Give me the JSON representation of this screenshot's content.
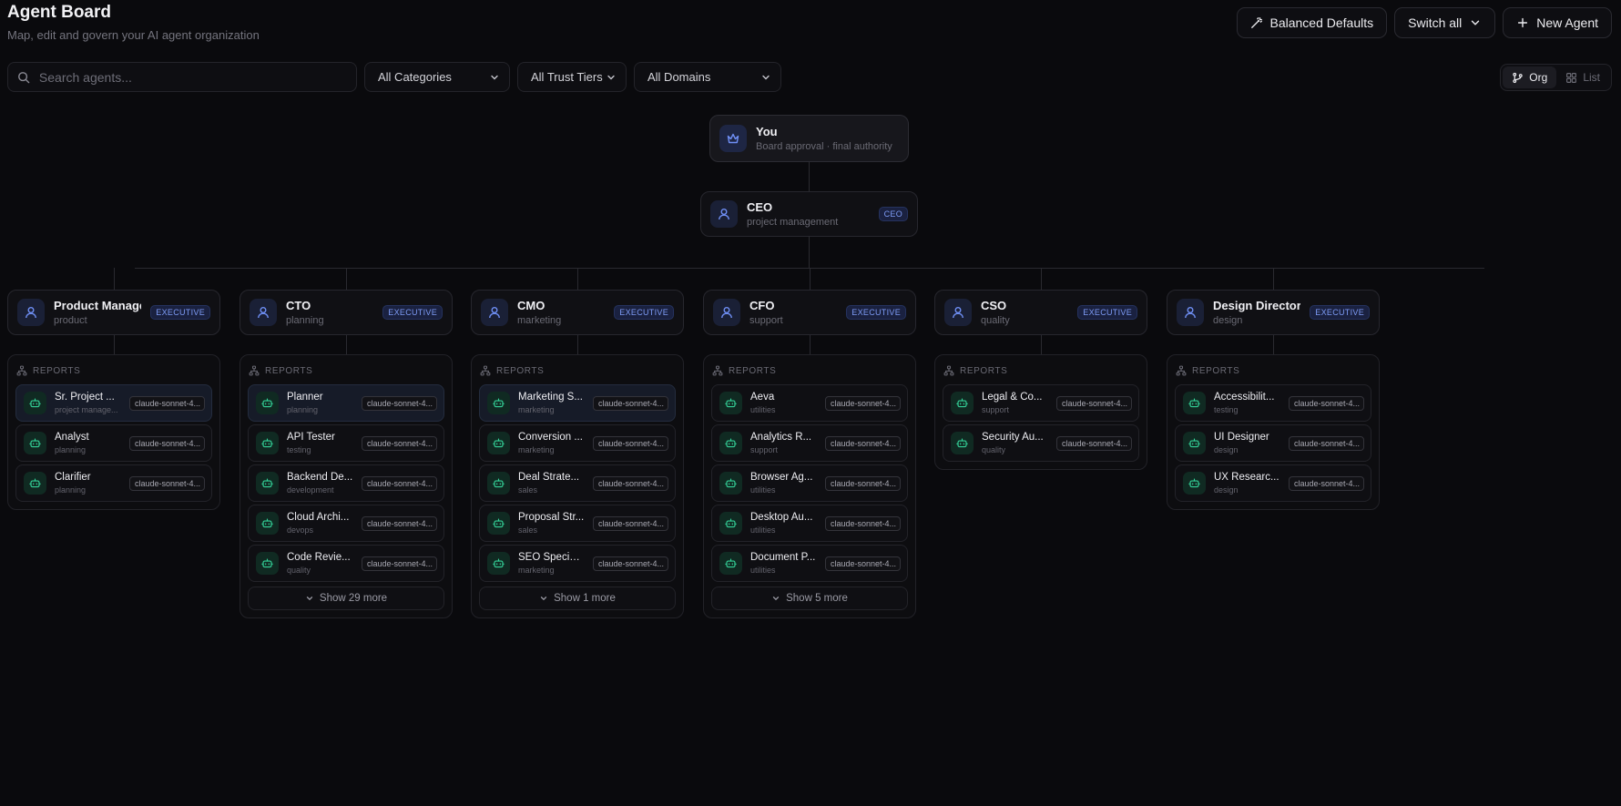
{
  "header": {
    "title": "Agent Board",
    "subtitle": "Map, edit and govern your AI agent organization"
  },
  "actions": {
    "balanced": "Balanced Defaults",
    "switch_all": "Switch all",
    "new_agent": "New Agent"
  },
  "search": {
    "placeholder": "Search agents..."
  },
  "filters": {
    "categories": "All Categories",
    "tiers": "All Trust Tiers",
    "domains": "All Domains"
  },
  "view": {
    "org": "Org",
    "list": "List",
    "active": "org"
  },
  "root": {
    "name": "You",
    "desc": "Board approval · final authority"
  },
  "ceo": {
    "name": "CEO",
    "desc": "project management",
    "badge": "CEO"
  },
  "reports_label": "REPORTS",
  "columns": [
    {
      "name": "Product Manager",
      "desc": "product",
      "badge": "EXECUTIVE",
      "reports": [
        {
          "name": "Sr. Project ...",
          "desc": "project manage...",
          "model": "claude-sonnet-4...",
          "highlight": true
        },
        {
          "name": "Analyst",
          "desc": "planning",
          "model": "claude-sonnet-4...",
          "highlight": false
        },
        {
          "name": "Clarifier",
          "desc": "planning",
          "model": "claude-sonnet-4...",
          "highlight": false
        }
      ],
      "more": ""
    },
    {
      "name": "CTO",
      "desc": "planning",
      "badge": "EXECUTIVE",
      "reports": [
        {
          "name": "Planner",
          "desc": "planning",
          "model": "claude-sonnet-4...",
          "highlight": true
        },
        {
          "name": "API Tester",
          "desc": "testing",
          "model": "claude-sonnet-4...",
          "highlight": false
        },
        {
          "name": "Backend De...",
          "desc": "development",
          "model": "claude-sonnet-4...",
          "highlight": false
        },
        {
          "name": "Cloud Archi...",
          "desc": "devops",
          "model": "claude-sonnet-4...",
          "highlight": false
        },
        {
          "name": "Code Revie...",
          "desc": "quality",
          "model": "claude-sonnet-4...",
          "highlight": false
        }
      ],
      "more": "Show 29 more"
    },
    {
      "name": "CMO",
      "desc": "marketing",
      "badge": "EXECUTIVE",
      "reports": [
        {
          "name": "Marketing S...",
          "desc": "marketing",
          "model": "claude-sonnet-4...",
          "highlight": true
        },
        {
          "name": "Conversion ...",
          "desc": "marketing",
          "model": "claude-sonnet-4...",
          "highlight": false
        },
        {
          "name": "Deal Strate...",
          "desc": "sales",
          "model": "claude-sonnet-4...",
          "highlight": false
        },
        {
          "name": "Proposal Str...",
          "desc": "sales",
          "model": "claude-sonnet-4...",
          "highlight": false
        },
        {
          "name": "SEO Special...",
          "desc": "marketing",
          "model": "claude-sonnet-4...",
          "highlight": false
        }
      ],
      "more": "Show 1 more"
    },
    {
      "name": "CFO",
      "desc": "support",
      "badge": "EXECUTIVE",
      "reports": [
        {
          "name": "Aeva",
          "desc": "utilities",
          "model": "claude-sonnet-4...",
          "highlight": false
        },
        {
          "name": "Analytics R...",
          "desc": "support",
          "model": "claude-sonnet-4...",
          "highlight": false
        },
        {
          "name": "Browser Ag...",
          "desc": "utilities",
          "model": "claude-sonnet-4...",
          "highlight": false
        },
        {
          "name": "Desktop Au...",
          "desc": "utilities",
          "model": "claude-sonnet-4...",
          "highlight": false
        },
        {
          "name": "Document P...",
          "desc": "utilities",
          "model": "claude-sonnet-4...",
          "highlight": false
        }
      ],
      "more": "Show 5 more"
    },
    {
      "name": "CSO",
      "desc": "quality",
      "badge": "EXECUTIVE",
      "reports": [
        {
          "name": "Legal & Co...",
          "desc": "support",
          "model": "claude-sonnet-4...",
          "highlight": false
        },
        {
          "name": "Security Au...",
          "desc": "quality",
          "model": "claude-sonnet-4...",
          "highlight": false
        }
      ],
      "more": ""
    },
    {
      "name": "Design Director",
      "desc": "design",
      "badge": "EXECUTIVE",
      "reports": [
        {
          "name": "Accessibilit...",
          "desc": "testing",
          "model": "claude-sonnet-4...",
          "highlight": false
        },
        {
          "name": "UI Designer",
          "desc": "design",
          "model": "claude-sonnet-4...",
          "highlight": false
        },
        {
          "name": "UX Researc...",
          "desc": "design",
          "model": "claude-sonnet-4...",
          "highlight": false
        }
      ],
      "more": ""
    }
  ]
}
